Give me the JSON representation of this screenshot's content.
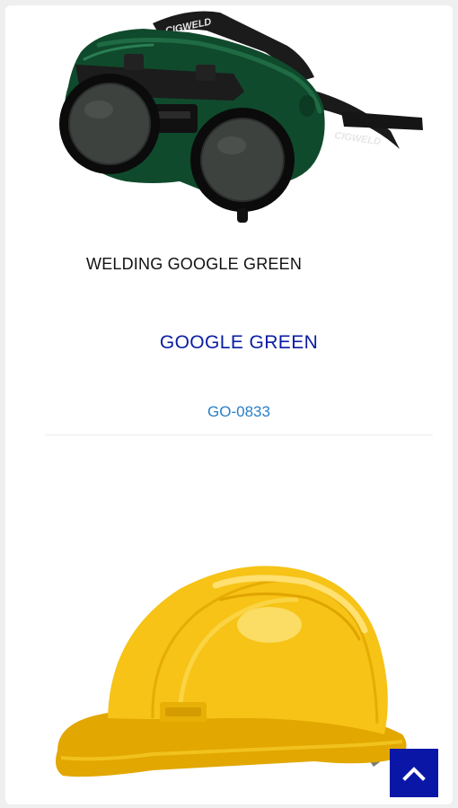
{
  "colors": {
    "product_name": "#0a1ca3",
    "product_code": "#2a80c8",
    "scroll_button": "#0a16a6"
  },
  "products": [
    {
      "image_caption": "WELDING GOOGLE GREEN",
      "name": "GOOGLE GREEN",
      "code": "GO-0833",
      "brand_marks": [
        "CIGWELD",
        "CIGWELD"
      ]
    },
    {
      "image_icon": "yellow-hard-hat"
    }
  ],
  "scroll_top": {
    "icon": "chevron-up-icon"
  }
}
